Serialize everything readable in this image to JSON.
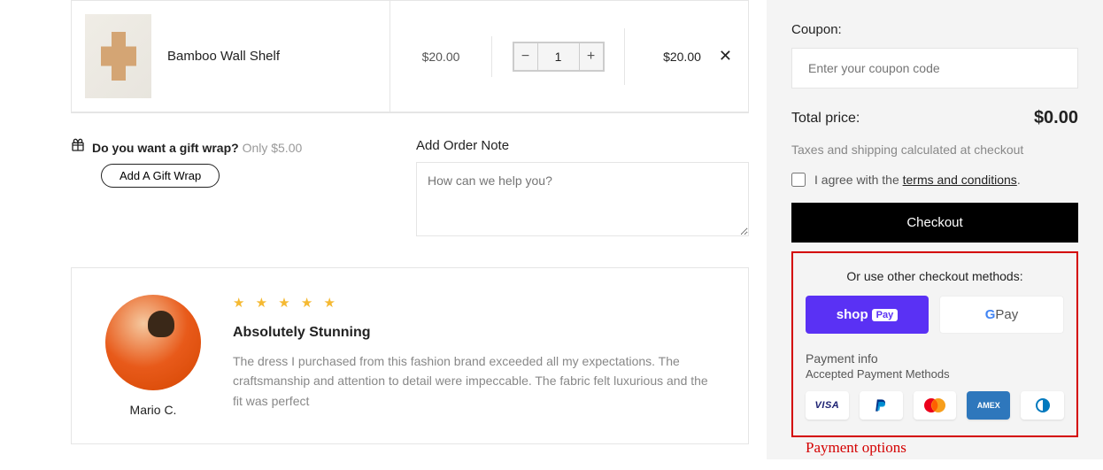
{
  "cart": {
    "items": [
      {
        "name": "Bamboo Wall Shelf",
        "price": "$20.00",
        "qty": "1",
        "subtotal": "$20.00"
      }
    ]
  },
  "giftwrap": {
    "question": "Do you want a gift wrap?",
    "only_label": "Only $5.00",
    "button": "Add A Gift Wrap"
  },
  "order_note": {
    "label": "Add Order Note",
    "placeholder": "How can we help you?"
  },
  "review": {
    "stars": "★ ★ ★ ★ ★",
    "title": "Absolutely Stunning",
    "text": "The dress I purchased from this fashion brand exceeded all my expectations. The craftsmanship and attention to detail were impeccable. The fabric felt luxurious and the fit was perfect",
    "reviewer": "Mario C."
  },
  "sidebar": {
    "coupon_label": "Coupon:",
    "coupon_placeholder": "Enter your coupon code",
    "total_label": "Total price:",
    "total_value": "$0.00",
    "taxes_note": "Taxes and shipping calculated at checkout",
    "agree_prefix": "I agree with the ",
    "agree_link": "terms and conditions",
    "checkout_label": "Checkout",
    "other_methods_label": "Or use other checkout methods:",
    "shoppay_text": "shop",
    "shoppay_badge": "Pay",
    "gpay_g": "G",
    "gpay_text": " Pay",
    "payment_info_title": "Payment info",
    "payment_info_sub": "Accepted Payment Methods",
    "cards": {
      "visa": "VISA",
      "amex": "AMEX"
    }
  },
  "annotation": "Payment options"
}
